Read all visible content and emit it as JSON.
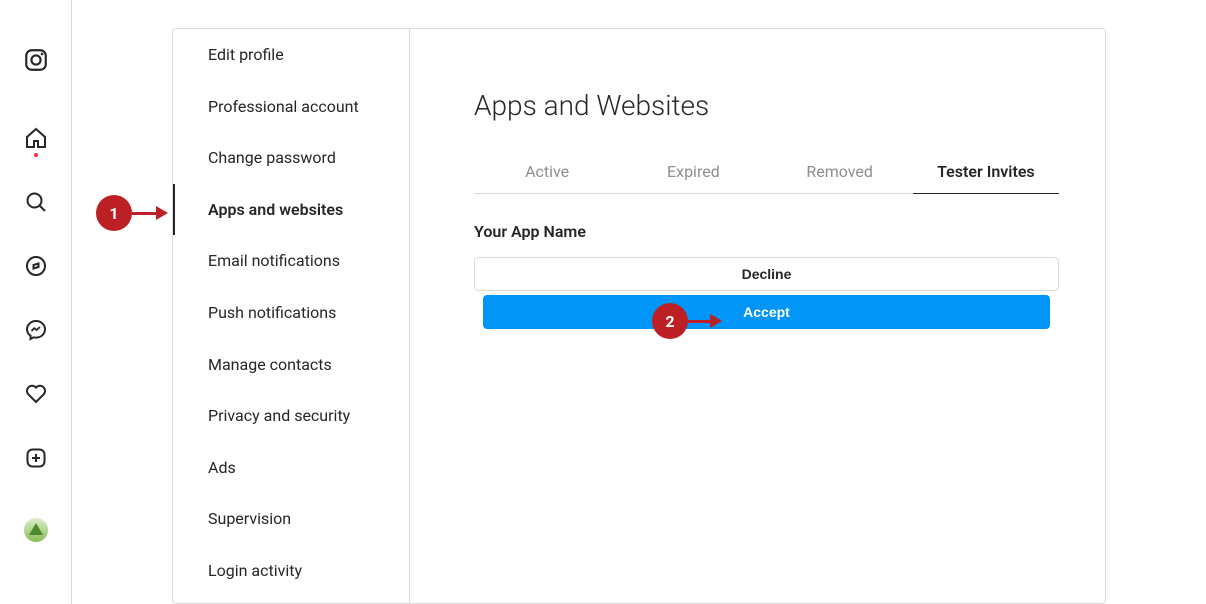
{
  "sidebar": {
    "items": [
      {
        "label": "Edit profile"
      },
      {
        "label": "Professional account"
      },
      {
        "label": "Change password"
      },
      {
        "label": "Apps and websites"
      },
      {
        "label": "Email notifications"
      },
      {
        "label": "Push notifications"
      },
      {
        "label": "Manage contacts"
      },
      {
        "label": "Privacy and security"
      },
      {
        "label": "Ads"
      },
      {
        "label": "Supervision"
      },
      {
        "label": "Login activity"
      }
    ],
    "active_index": 3
  },
  "page": {
    "title": "Apps and Websites",
    "tabs": [
      {
        "label": "Active"
      },
      {
        "label": "Expired"
      },
      {
        "label": "Removed"
      },
      {
        "label": "Tester Invites"
      }
    ],
    "active_tab_index": 3
  },
  "invite": {
    "app_name": "Your App Name",
    "decline_label": "Decline",
    "accept_label": "Accept"
  },
  "callouts": {
    "one": "1",
    "two": "2"
  }
}
